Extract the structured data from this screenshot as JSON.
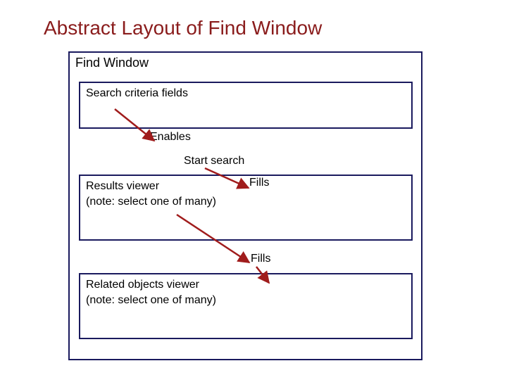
{
  "title": "Abstract Layout of Find Window",
  "outer": {
    "label": "Find Window"
  },
  "box_criteria": {
    "label": "Search criteria fields"
  },
  "flow_enables": "Enables",
  "flow_start": "Start search",
  "box_results": {
    "line1": "Results viewer",
    "line2": "(note: select one of many)"
  },
  "flow_fills_1": "Fills",
  "flow_fills_2": "Fills",
  "box_related": {
    "line1": "Related objects viewer",
    "line2": "(note: select one of many)"
  }
}
